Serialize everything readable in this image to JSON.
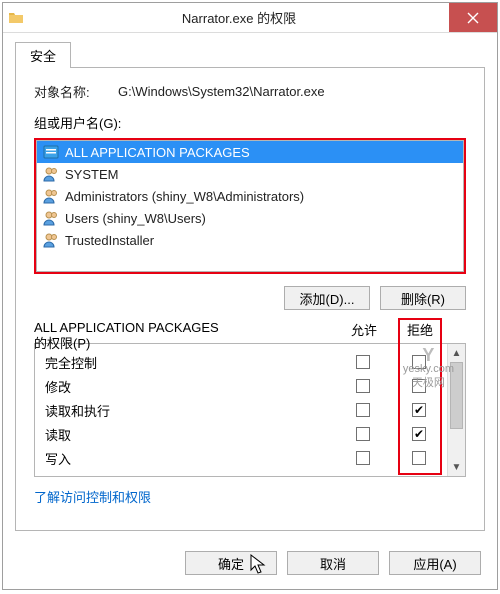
{
  "title": "Narrator.exe 的权限",
  "tab": {
    "security": "安全"
  },
  "object": {
    "label": "对象名称:",
    "path": "G:\\Windows\\System32\\Narrator.exe"
  },
  "group_users_label": "组或用户名(G):",
  "users": [
    {
      "name": "ALL APPLICATION PACKAGES",
      "type": "package",
      "selected": true
    },
    {
      "name": "SYSTEM",
      "type": "user",
      "selected": false
    },
    {
      "name": "Administrators (shiny_W8\\Administrators)",
      "type": "group",
      "selected": false
    },
    {
      "name": "Users (shiny_W8\\Users)",
      "type": "group",
      "selected": false
    },
    {
      "name": "TrustedInstaller",
      "type": "user",
      "selected": false
    }
  ],
  "buttons": {
    "add": "添加(D)...",
    "remove": "删除(R)",
    "ok": "确定",
    "cancel": "取消",
    "apply": "应用(A)"
  },
  "perm_title_1": "ALL APPLICATION PACKAGES",
  "perm_title_2": "的权限(P)",
  "columns": {
    "allow": "允许",
    "deny": "拒绝"
  },
  "permissions": [
    {
      "label": "完全控制",
      "allow": false,
      "deny": false
    },
    {
      "label": "修改",
      "allow": false,
      "deny": false
    },
    {
      "label": "读取和执行",
      "allow": false,
      "deny": true
    },
    {
      "label": "读取",
      "allow": false,
      "deny": true
    },
    {
      "label": "写入",
      "allow": false,
      "deny": false
    }
  ],
  "link": "了解访问控制和权限",
  "watermark": {
    "logo": "Y",
    "line1": "yesky.com",
    "line2": "天极网"
  }
}
